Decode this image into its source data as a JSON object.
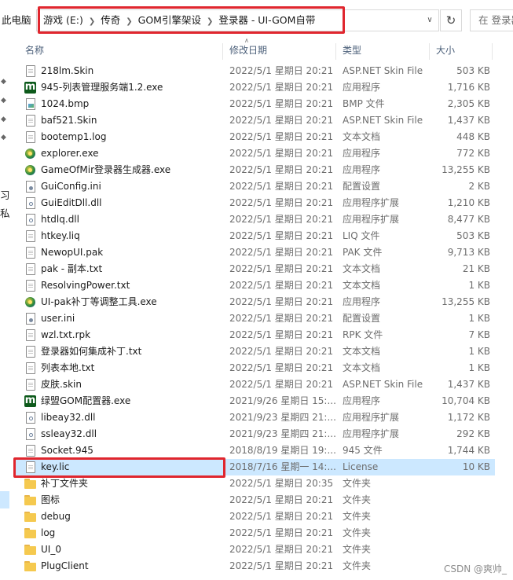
{
  "address": {
    "left_label": "此电脑",
    "crumbs": [
      "游戏 (E:)",
      "传奇",
      "GOM引擎架设",
      "登录器 - UI-GOM自带"
    ],
    "refresh_glyph": "↻",
    "search_placeholder": "在 登录器"
  },
  "nav": {
    "fragment_1": "习",
    "fragment_2": "私"
  },
  "columns": {
    "name": "名称",
    "date": "修改日期",
    "type": "类型",
    "size": "大小"
  },
  "files": [
    {
      "name": "218lm.Skin",
      "date": "2022/5/1 星期日 20:21",
      "type": "ASP.NET Skin File",
      "size": "503 KB",
      "icon": "file"
    },
    {
      "name": "945-列表管理服务端1.2.exe",
      "date": "2022/5/1 星期日 20:21",
      "type": "应用程序",
      "size": "1,716 KB",
      "icon": "exeg"
    },
    {
      "name": "1024.bmp",
      "date": "2022/5/1 星期日 20:21",
      "type": "BMP 文件",
      "size": "2,305 KB",
      "icon": "bmp"
    },
    {
      "name": "baf521.Skin",
      "date": "2022/5/1 星期日 20:21",
      "type": "ASP.NET Skin File",
      "size": "1,437 KB",
      "icon": "file"
    },
    {
      "name": "bootemp1.log",
      "date": "2022/5/1 星期日 20:21",
      "type": "文本文档",
      "size": "448 KB",
      "icon": "file"
    },
    {
      "name": "explorer.exe",
      "date": "2022/5/1 星期日 20:21",
      "type": "应用程序",
      "size": "772 KB",
      "icon": "exew"
    },
    {
      "name": "GameOfMir登录器生成器.exe",
      "date": "2022/5/1 星期日 20:21",
      "type": "应用程序",
      "size": "13,255 KB",
      "icon": "exew"
    },
    {
      "name": "GuiConfig.ini",
      "date": "2022/5/1 星期日 20:21",
      "type": "配置设置",
      "size": "2 KB",
      "icon": "ini"
    },
    {
      "name": "GuiEditDll.dll",
      "date": "2022/5/1 星期日 20:21",
      "type": "应用程序扩展",
      "size": "1,210 KB",
      "icon": "dll"
    },
    {
      "name": "htdlq.dll",
      "date": "2022/5/1 星期日 20:21",
      "type": "应用程序扩展",
      "size": "8,477 KB",
      "icon": "dll"
    },
    {
      "name": "htkey.liq",
      "date": "2022/5/1 星期日 20:21",
      "type": "LIQ 文件",
      "size": "503 KB",
      "icon": "file"
    },
    {
      "name": "NewopUI.pak",
      "date": "2022/5/1 星期日 20:21",
      "type": "PAK 文件",
      "size": "9,713 KB",
      "icon": "file"
    },
    {
      "name": "pak - 副本.txt",
      "date": "2022/5/1 星期日 20:21",
      "type": "文本文档",
      "size": "21 KB",
      "icon": "file"
    },
    {
      "name": "ResolvingPower.txt",
      "date": "2022/5/1 星期日 20:21",
      "type": "文本文档",
      "size": "1 KB",
      "icon": "file"
    },
    {
      "name": "UI-pak补丁等调整工具.exe",
      "date": "2022/5/1 星期日 20:21",
      "type": "应用程序",
      "size": "13,255 KB",
      "icon": "exew"
    },
    {
      "name": "user.ini",
      "date": "2022/5/1 星期日 20:21",
      "type": "配置设置",
      "size": "1 KB",
      "icon": "ini"
    },
    {
      "name": "wzl.txt.rpk",
      "date": "2022/5/1 星期日 20:21",
      "type": "RPK 文件",
      "size": "7 KB",
      "icon": "file"
    },
    {
      "name": "登录器如何集成补丁.txt",
      "date": "2022/5/1 星期日 20:21",
      "type": "文本文档",
      "size": "1 KB",
      "icon": "file"
    },
    {
      "name": "列表本地.txt",
      "date": "2022/5/1 星期日 20:21",
      "type": "文本文档",
      "size": "1 KB",
      "icon": "file"
    },
    {
      "name": "皮肤.skin",
      "date": "2022/5/1 星期日 20:21",
      "type": "ASP.NET Skin File",
      "size": "1,437 KB",
      "icon": "file"
    },
    {
      "name": "绿盟GOM配置器.exe",
      "date": "2021/9/26 星期日 15:...",
      "type": "应用程序",
      "size": "10,704 KB",
      "icon": "exeg"
    },
    {
      "name": "libeay32.dll",
      "date": "2021/9/23 星期四 21:...",
      "type": "应用程序扩展",
      "size": "1,172 KB",
      "icon": "dll"
    },
    {
      "name": "ssleay32.dll",
      "date": "2021/9/23 星期四 21:...",
      "type": "应用程序扩展",
      "size": "292 KB",
      "icon": "dll"
    },
    {
      "name": "Socket.945",
      "date": "2018/8/19 星期日 19:...",
      "type": "945 文件",
      "size": "1,744 KB",
      "icon": "file"
    },
    {
      "name": "key.lic",
      "date": "2018/7/16 星期一 14:...",
      "type": "License",
      "size": "10 KB",
      "icon": "file",
      "selected": true
    },
    {
      "name": "补丁文件夹",
      "date": "2022/5/1 星期日 20:35",
      "type": "文件夹",
      "size": "",
      "icon": "folder"
    },
    {
      "name": "图标",
      "date": "2022/5/1 星期日 20:21",
      "type": "文件夹",
      "size": "",
      "icon": "folder"
    },
    {
      "name": "debug",
      "date": "2022/5/1 星期日 20:21",
      "type": "文件夹",
      "size": "",
      "icon": "folder"
    },
    {
      "name": "log",
      "date": "2022/5/1 星期日 20:21",
      "type": "文件夹",
      "size": "",
      "icon": "folder"
    },
    {
      "name": "UI_0",
      "date": "2022/5/1 星期日 20:21",
      "type": "文件夹",
      "size": "",
      "icon": "folder"
    },
    {
      "name": "PlugClient",
      "date": "2022/5/1 星期日 20:21",
      "type": "文件夹",
      "size": "",
      "icon": "folder"
    }
  ],
  "watermark": "CSDN @爽帅_",
  "colors": {
    "selection": "#cce8ff",
    "highlight_box": "#e0262e",
    "header_text": "#4c607a"
  }
}
